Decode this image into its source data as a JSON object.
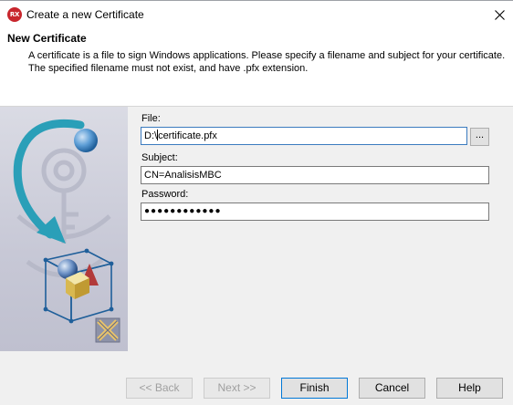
{
  "window": {
    "icon_text": "RX",
    "title": "Create a new Certificate"
  },
  "header": {
    "title": "New Certificate",
    "description": "A certificate is a file to sign Windows applications. Please specify a filename and subject for your certificate. The specified filename must not exist, and have .pfx extension."
  },
  "form": {
    "file_label": "File:",
    "file_value_before_caret": "D:\\",
    "file_value_after_caret": "certificate.pfx",
    "browse_label": "...",
    "subject_label": "Subject:",
    "subject_value": "CN=AnalisisMBC",
    "password_label": "Password:",
    "password_value": "●●●●●●●●●●●●"
  },
  "buttons": {
    "back": "<< Back",
    "next": "Next >>",
    "finish": "Finish",
    "cancel": "Cancel",
    "help": "Help"
  },
  "icons": {
    "close": "close-icon",
    "wizard_art": "certificate-wizard-graphic"
  },
  "colors": {
    "app_icon": "#c8262d",
    "focus_border": "#3b7bbf",
    "art_arrow": "#2a9fb8"
  }
}
